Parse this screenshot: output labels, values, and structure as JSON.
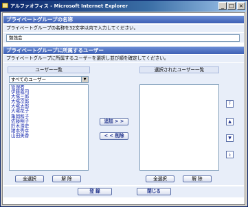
{
  "window": {
    "title": "アルファオフィス - Microsoft Internet Explorer",
    "minimize_glyph": "_",
    "maximize_glyph": "□",
    "close_glyph": "×"
  },
  "group_name": {
    "header": "プライベートグループの名称",
    "description": "プライベートグループの名称を32文字以内で入力してください。",
    "value": "勉強会"
  },
  "members": {
    "header": "プライベートグループに所属するユーザー",
    "description": "プライベートグループに所属するユーザーを選択し並び順を確定してください。",
    "left_label": "ユーザー一覧",
    "right_label": "選択されたユーザー一覧",
    "filter_value": "すべてのユーザー",
    "users": [
      "管理者",
      "伊藤義司",
      "大塚三郎",
      "大塚次郎",
      "大塚太郎",
      "大塚花子",
      "亀岡和子",
      "佐藤明子",
      "鈴木浩史",
      "猪本秀幸",
      "山田美香"
    ],
    "add_button": "追加 > >",
    "remove_button": "< < 削除",
    "left_select_all": "全選択",
    "left_clear": "解 除",
    "right_select_all": "全選択",
    "right_clear": "解 除"
  },
  "footer": {
    "register_button": "登 録",
    "close_button": "閉じる"
  }
}
